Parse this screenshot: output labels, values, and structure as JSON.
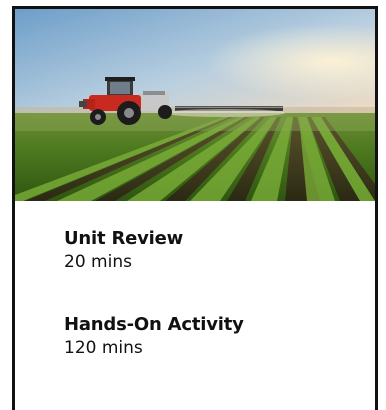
{
  "card": {
    "image": {
      "subject": "tractor spraying crop field at sunset"
    },
    "items": [
      {
        "title": "Unit Review",
        "duration": "20 mins"
      },
      {
        "title": "Hands-On Activity",
        "duration": "120 mins"
      }
    ]
  },
  "colors": {
    "border": "#111111",
    "text": "#111111",
    "background": "#ffffff"
  }
}
